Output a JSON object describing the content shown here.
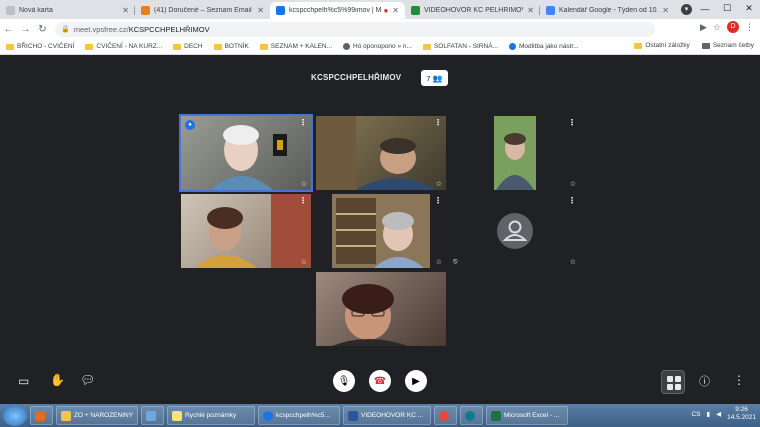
{
  "browser": {
    "tabs": [
      {
        "label": "Nová karta",
        "color": "#bdc1c6"
      },
      {
        "label": "(41) Doručené – Seznam Email",
        "color": "#e67e22"
      },
      {
        "label": "kcspcchpelh%c5%99imov | M",
        "color": "#1a73e8",
        "active": true
      },
      {
        "label": "VIDEOHOVOR KC PELHŘIMOV",
        "color": "#1e8e3e"
      },
      {
        "label": "Kalendář Google - Týden od 10. k",
        "color": "#4285f4"
      }
    ],
    "new_tab": "+",
    "profile_initial": "D",
    "url_host": "meet.vpsfree.cz/",
    "url_path": "KCSPCCHPELHŘIMOV",
    "minimize": "—",
    "maximize": "☐",
    "close": "✕"
  },
  "bookmarks": {
    "items": [
      "BŘICHO - CVIČENÍ",
      "CVIČENÍ - NA KURZ...",
      "DECH",
      "BOTNÍK",
      "SEZNAM + KALEN...",
      "Hó oponopono » n...",
      "SOLFATAN - SIRNÁ...",
      "Modlitba jako nástr..."
    ],
    "other": "Ostatní záložky",
    "reading": "Seznam četby"
  },
  "meeting": {
    "title": "KCSPCCHPELHŘIMOV",
    "participants_count": "7",
    "participants_icon": "people-icon",
    "tiles": [
      {
        "name": "participant-1",
        "bg": "#7c7f7a",
        "active": true
      },
      {
        "name": "participant-2",
        "bg": "#4e4a3c"
      },
      {
        "name": "participant-3",
        "bg": "#5d7a4a"
      },
      {
        "name": "participant-4",
        "bg": "#8a7a6a"
      },
      {
        "name": "participant-5",
        "bg": "#6b5a48"
      },
      {
        "name": "participant-6-avatar",
        "bg": "#202124"
      },
      {
        "name": "participant-7",
        "bg": "#5a3f38"
      }
    ]
  },
  "taskbar": {
    "items": [
      {
        "label": "",
        "color": "#e56b1f"
      },
      {
        "label": "ZO + NAROZENINY",
        "color": "#f4c542"
      },
      {
        "label": "",
        "color": "#6fa8dc"
      },
      {
        "label": "Rychlé poznámky",
        "color": "#f6e27a"
      },
      {
        "label": "kcspcchpelh%c5...",
        "color": "#1a73e8"
      },
      {
        "label": "VIDEOHOVOR KC ...",
        "color": "#2b579a"
      },
      {
        "label": "",
        "color": "#e8453c"
      },
      {
        "label": "",
        "color": "#0f7b8a"
      },
      {
        "label": "Microsoft Excel - ...",
        "color": "#1e7145"
      }
    ],
    "lang": "CS",
    "time": "9:26",
    "date": "14.5.2021"
  }
}
